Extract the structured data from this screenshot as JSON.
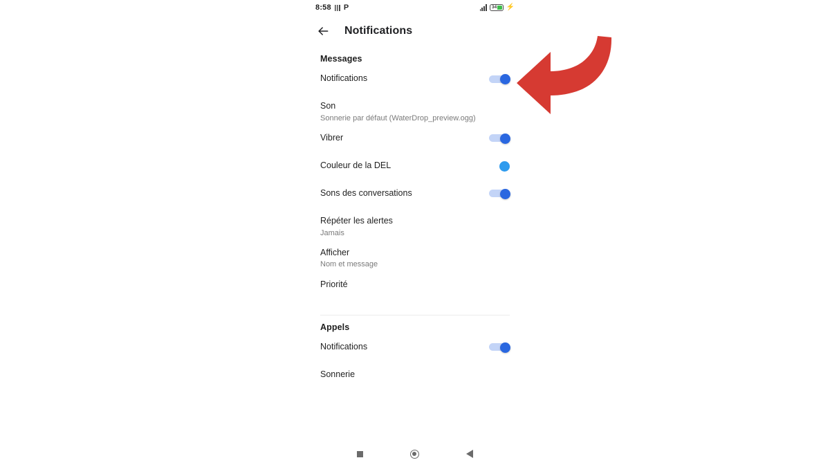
{
  "status_bar": {
    "time": "8:58",
    "left_icons": [
      "sim-card-icon",
      "p-mode-icon"
    ],
    "signal_icon": "signal-bars-icon",
    "battery_level": "34",
    "battery_color": "#3ebd4c",
    "charging_icon": "charging-bolt-icon"
  },
  "app_bar": {
    "back_icon": "back-arrow-icon",
    "title": "Notifications"
  },
  "sections": [
    {
      "header": "Messages",
      "rows": [
        {
          "title": "Notifications",
          "sub": "",
          "control": "switch",
          "state": "on"
        },
        {
          "title": "Son",
          "sub": "Sonnerie par défaut (WaterDrop_preview.ogg)",
          "control": "none",
          "state": ""
        },
        {
          "title": "Vibrer",
          "sub": "",
          "control": "switch",
          "state": "on"
        },
        {
          "title": "Couleur de la DEL",
          "sub": "",
          "control": "color",
          "state": "#2e9bee"
        },
        {
          "title": "Sons des conversations",
          "sub": "",
          "control": "switch",
          "state": "on"
        },
        {
          "title": "Répéter les alertes",
          "sub": "Jamais",
          "control": "none",
          "state": ""
        },
        {
          "title": "Afficher",
          "sub": "Nom et message",
          "control": "none",
          "state": ""
        },
        {
          "title": "Priorité",
          "sub": "",
          "control": "none",
          "state": ""
        }
      ]
    },
    {
      "header": "Appels",
      "rows": [
        {
          "title": "Notifications",
          "sub": "",
          "control": "switch",
          "state": "on"
        },
        {
          "title": "Sonnerie",
          "sub": "",
          "control": "none",
          "state": ""
        }
      ]
    }
  ],
  "nav_bar": {
    "recents": "recents-square-icon",
    "home": "home-circle-icon",
    "back": "back-triangle-icon"
  },
  "annotation": {
    "type": "curved-left-arrow",
    "color": "#d63a32",
    "points_at": "Messages Notifications toggle"
  },
  "colors": {
    "switch_track": "#c3d4f7",
    "switch_thumb": "#2a67e0",
    "led_swatch": "#2e9bee",
    "annotation_red": "#d63a32",
    "divider": "#ebebeb",
    "text_primary": "#1f1f1f",
    "text_secondary": "#7a7a7a"
  }
}
